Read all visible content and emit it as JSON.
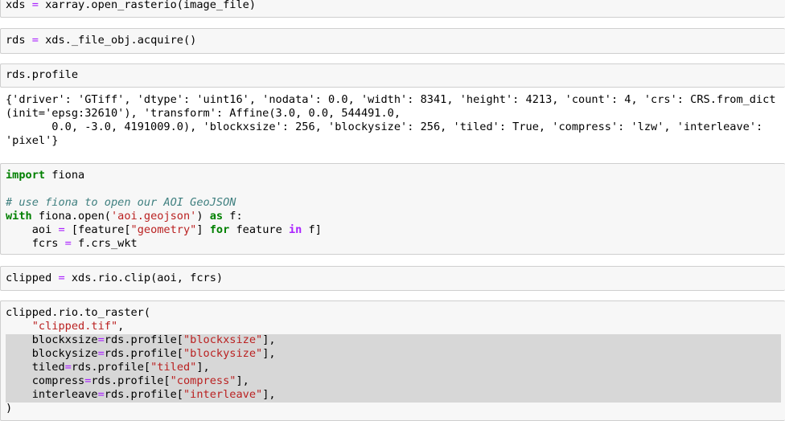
{
  "cells": {
    "c1": {
      "lhs": "xds",
      "op": "=",
      "rhs": "xarray.open_rasterio(image_file)"
    },
    "c2": {
      "lhs": "rds",
      "op": "=",
      "rhs": "xds._file_obj.acquire()"
    },
    "c3": {
      "code": "rds.profile"
    },
    "c3_output": "{'driver': 'GTiff', 'dtype': 'uint16', 'nodata': 0.0, 'width': 8341, 'height': 4213, 'count': 4, 'crs': CRS.from_dict(init='epsg:32610'), 'transform': Affine(3.0, 0.0, 544491.0,\n       0.0, -3.0, 4191009.0), 'blockxsize': 256, 'blockysize': 256, 'tiled': True, 'compress': 'lzw', 'interleave': 'pixel'}",
    "c4": {
      "l1_kw": "import",
      "l1_rest": " fiona",
      "comment": "# use fiona to open our AOI GeoJSON",
      "l3_kw": "with",
      "l3_a": " fiona.open(",
      "l3_str": "'aoi.geojson'",
      "l3_b": ") ",
      "l3_as": "as",
      "l3_c": " f:",
      "l4_a": "    aoi ",
      "l4_op": "=",
      "l4_b": " [feature[",
      "l4_str": "\"geometry\"",
      "l4_c": "] ",
      "l4_for": "for",
      "l4_d": " feature ",
      "l4_in": "in",
      "l4_e": " f]",
      "l5_a": "    fcrs ",
      "l5_op": "=",
      "l5_b": " f.crs_wkt"
    },
    "c5": {
      "lhs": "clipped",
      "op": "=",
      "rhs": " xds.rio.clip(aoi, fcrs)"
    },
    "c6": {
      "l1": "clipped.rio.to_raster(",
      "l2_indent": "    ",
      "l2_str": "\"clipped.tif\"",
      "l2_end": ",",
      "l3_a": "    blockxsize",
      "l3_op": "=",
      "l3_b": "rds.profile[",
      "l3_str": "\"blockxsize\"",
      "l3_c": "],",
      "l4_a": "    blockysize",
      "l4_op": "=",
      "l4_b": "rds.profile[",
      "l4_str": "\"blockysize\"",
      "l4_c": "],",
      "l5_a": "    tiled",
      "l5_op": "=",
      "l5_b": "rds.profile[",
      "l5_str": "\"tiled\"",
      "l5_c": "],",
      "l6_a": "    compress",
      "l6_op": "=",
      "l6_b": "rds.profile[",
      "l6_str": "\"compress\"",
      "l6_c": "],",
      "l7_a": "    interleave",
      "l7_op": "=",
      "l7_b": "rds.profile[",
      "l7_str": "\"interleave\"",
      "l7_c": "],",
      "l8": ")"
    }
  }
}
